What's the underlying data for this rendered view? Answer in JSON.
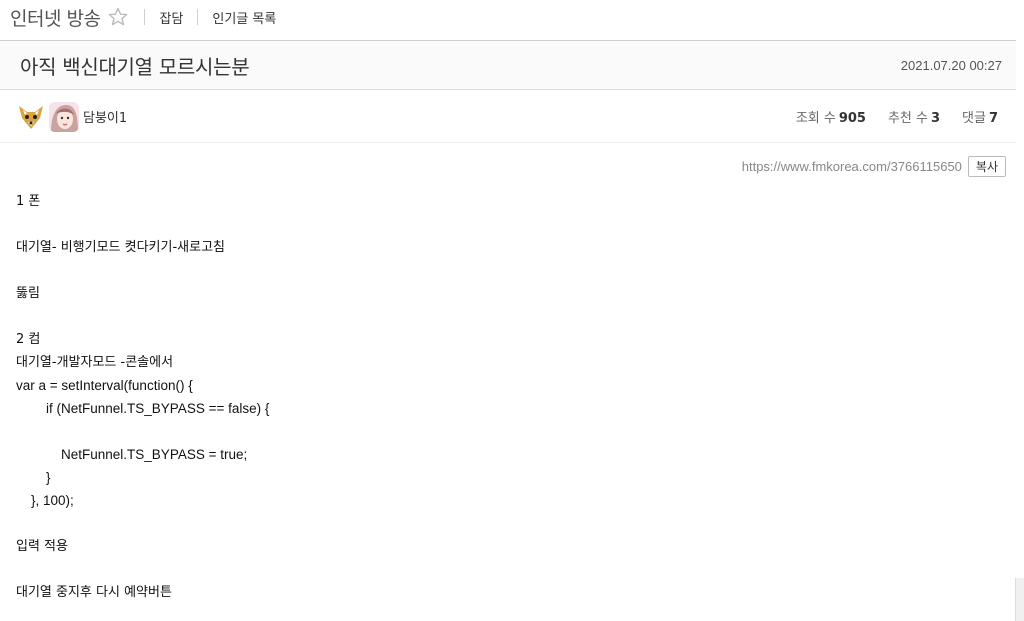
{
  "nav": {
    "board_title": "인터넷 방송",
    "favorite_icon": "star-outline-icon",
    "links": [
      "잡담",
      "인기글 목록"
    ]
  },
  "post": {
    "title": "아직 백신대기열 모르시는분",
    "date": "2021.07.20 00:27",
    "author": "담붕이1",
    "stats": {
      "views_label": "조회 수",
      "views": "905",
      "recommend_label": "추천 수",
      "recommend": "3",
      "comments_label": "댓글",
      "comments": "7"
    },
    "url": "https://www.fmkorea.com/3766115650",
    "copy_label": "복사"
  },
  "body": {
    "lines": [
      "1 폰",
      "",
      "대기열- 비행기모드 켯다키기-새로고침",
      "",
      "뚫림",
      "",
      "2 컴",
      "대기열-개발자모드 -콘솔에서",
      "var a = setInterval(function() {",
      "        if (NetFunnel.TS_BYPASS == false) {",
      "",
      "            NetFunnel.TS_BYPASS = true;",
      "        }",
      "    }, 100);",
      "",
      "입력 적용",
      "",
      "대기열 중지후 다시 예약버튼"
    ]
  },
  "colors": {
    "header_bg": "#fafafa",
    "border": "#cfcfcf",
    "text": "#333333"
  }
}
